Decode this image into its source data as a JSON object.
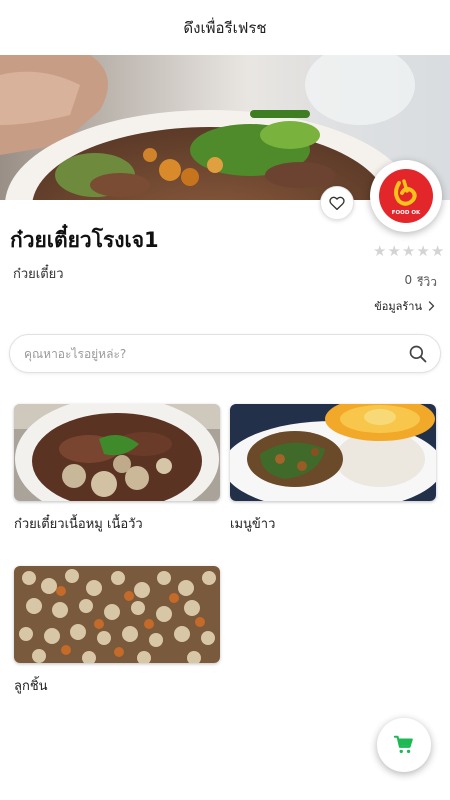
{
  "header": {
    "title": "ดึงเพื่อรีเฟรช"
  },
  "shop": {
    "name": "ก๋วยเตี๋ยวโรงเจ1",
    "category": "ก๋วยเตี๋ยว",
    "rating": 0,
    "rating_max": 5,
    "review_count": "0",
    "review_label": "รีวิว",
    "info_link": "ข้อมูลร้าน",
    "logo_text": "FOOD OK"
  },
  "search": {
    "placeholder": "คุณหาอะไรอยู่หล่ะ?",
    "value": ""
  },
  "menu": {
    "items": [
      {
        "label": "ก๋วยเตี๋ยวเนื้อหมู เนื้อวัว",
        "image": "noodle-soup-bowl"
      },
      {
        "label": "เมนูข้าว",
        "image": "basil-rice-fried-egg"
      },
      {
        "label": "ลูกชิ้น",
        "image": "meatballs"
      }
    ]
  },
  "colors": {
    "accent_green": "#1db954",
    "logo_red": "#e3262a",
    "logo_yellow": "#f6c21b",
    "star_empty": "#d4d4d4"
  },
  "icons": {
    "favorite": "heart-outline-icon",
    "search": "magnifier-icon",
    "cart": "shopping-cart-icon",
    "chevron": "chevron-right-icon"
  }
}
